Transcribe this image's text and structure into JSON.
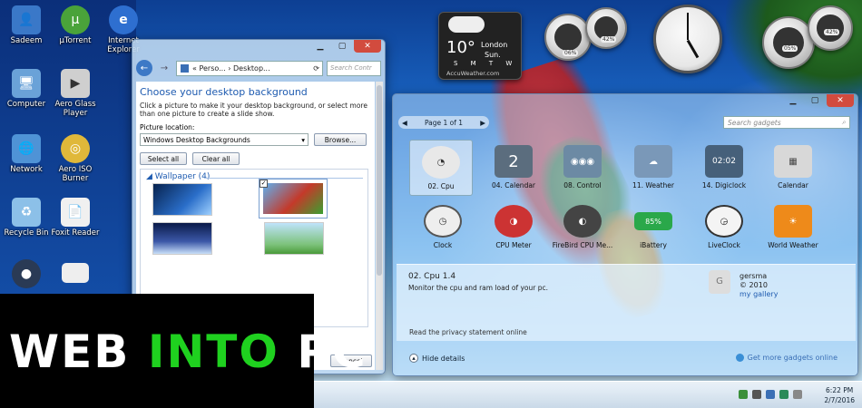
{
  "desktop_icons": [
    {
      "label": "Sadeem",
      "icon": "user-folder-icon",
      "color": "#3a78c8"
    },
    {
      "label": "µTorrent",
      "icon": "utorrent-icon",
      "color": "#4aa33a"
    },
    {
      "label": "Internet Explorer",
      "icon": "internet-explorer-icon",
      "color": "#2e6fd0"
    },
    {
      "label": "Computer",
      "icon": "computer-icon",
      "color": "#6aa2d8"
    },
    {
      "label": "Aero Glass Player",
      "icon": "media-player-icon",
      "color": "#cfcfcf"
    },
    {
      "label": "Network",
      "icon": "network-icon",
      "color": "#4f93d6"
    },
    {
      "label": "Aero ISO Burner",
      "icon": "disc-burner-icon",
      "color": "#e0b83a"
    },
    {
      "label": "Recycle Bin",
      "icon": "recycle-bin-icon",
      "color": "#8cc0e8"
    },
    {
      "label": "Foxit Reader",
      "icon": "pdf-reader-icon",
      "color": "#f0f0f0"
    }
  ],
  "weather_gadget": {
    "temp": "10°",
    "city": "London",
    "day": "Sun.",
    "days": "S M T W",
    "brand": "AccuWeather.com"
  },
  "meters": {
    "cpu_a": "06%",
    "ram_a": "42%",
    "cpu_b": "05%",
    "ram_b": "42%"
  },
  "bg_window": {
    "address": "« Perso... › Desktop...",
    "search_placeholder": "Search Contr",
    "heading": "Choose your desktop background",
    "instruction": "Click a picture to make it your desktop background, or select more than one picture to create a slide show.",
    "picture_location_label": "Picture location:",
    "picture_location_value": "Windows Desktop Backgrounds",
    "browse_label": "Browse...",
    "select_all_label": "Select all",
    "clear_all_label": "Clear all",
    "group_label": "Wallpaper (4)",
    "cancel_label": "Cancel"
  },
  "gadget_window": {
    "page_label": "Page 1 of 1",
    "search_placeholder": "Search gadgets",
    "tiles": [
      {
        "label": "02. Cpu",
        "color": "#e8e8e8",
        "selected": true
      },
      {
        "label": "04. Calendar",
        "color": "#5b6d7e"
      },
      {
        "label": "08. Control",
        "color": "#6c8aa4"
      },
      {
        "label": "11. Weather",
        "color": "#7a98b8"
      },
      {
        "label": "14. Digiclock",
        "color": "#46607a"
      },
      {
        "label": "Calendar",
        "color": "#d8d8d8"
      },
      {
        "label": "Clock",
        "color": "#eeeeee"
      },
      {
        "label": "CPU Meter",
        "color": "#cc3333"
      },
      {
        "label": "FireBird CPU Me...",
        "color": "#444444"
      },
      {
        "label": "iBattery",
        "color": "#2aa84a"
      },
      {
        "label": "LiveClock",
        "color": "#f4f4f4"
      },
      {
        "label": "World Weather",
        "color": "#ee8a1a"
      }
    ],
    "detail_title": "02. Cpu 1.4",
    "detail_desc": "Monitor the cpu and ram load of your pc.",
    "author": "gersma",
    "author_year": "© 2010",
    "author_link": "my gallery",
    "privacy_link": "Read the privacy statement online",
    "hide_details": "Hide details",
    "get_more": "Get more gadgets online"
  },
  "battery_text": "85%",
  "digiclock_text": "02:02",
  "calendar_day": "2",
  "taskbar": {
    "time": "6:22 PM",
    "date": "2/7/2016"
  },
  "overlay": {
    "part1": "WEB",
    "part2": "INTO",
    "part3": "PC"
  }
}
